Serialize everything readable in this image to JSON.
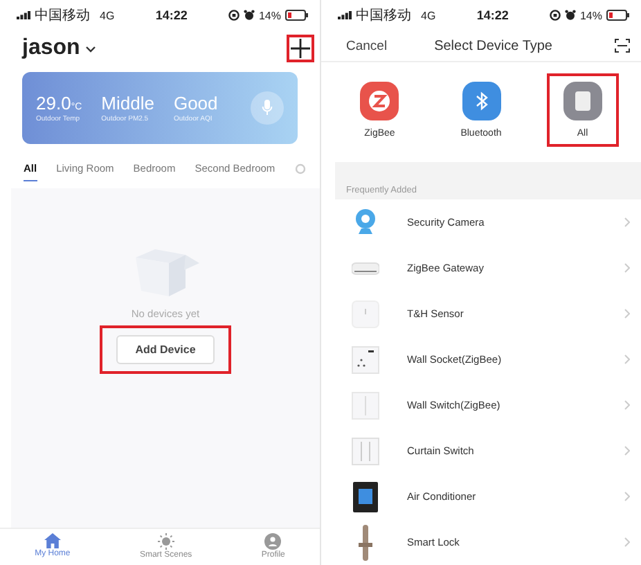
{
  "status_bars": [
    {
      "carrier": "中国移动",
      "network": "4G",
      "time": "14:22",
      "battery": "14%"
    },
    {
      "carrier": "中国移动",
      "network": "4G",
      "time": "14:22",
      "battery": "14%"
    }
  ],
  "home": {
    "home_name": "jason",
    "add_highlighted": true,
    "weather": [
      {
        "value": "29.0",
        "unit": "°C",
        "label": "Outdoor Temp"
      },
      {
        "value": "Middle",
        "label": "Outdoor PM2.5"
      },
      {
        "value": "Good",
        "label": "Outdoor AQI"
      }
    ],
    "rooms": [
      {
        "label": "All",
        "selected": true
      },
      {
        "label": "Living Room",
        "selected": false
      },
      {
        "label": "Bedroom",
        "selected": false
      },
      {
        "label": "Second Bedroom",
        "selected": false
      }
    ],
    "empty_message": "No devices yet",
    "add_device": {
      "label": "Add Device",
      "highlighted": true
    },
    "nav": [
      {
        "label": "My Home",
        "kind": "home",
        "selected": true
      },
      {
        "label": "Smart Scenes",
        "kind": "scenes",
        "selected": false
      },
      {
        "label": "Profile",
        "kind": "profile",
        "selected": false
      }
    ]
  },
  "select_type": {
    "cancel": "Cancel",
    "title": "Select Device Type",
    "types": [
      {
        "label": "ZigBee",
        "kind": "zigbee",
        "highlighted": false
      },
      {
        "label": "Bluetooth",
        "kind": "bluetooth",
        "highlighted": false
      },
      {
        "label": "All",
        "kind": "all",
        "highlighted": true
      }
    ],
    "section": "Frequently Added",
    "devices": [
      {
        "name": "Security Camera",
        "kind": "camera"
      },
      {
        "name": "ZigBee Gateway",
        "kind": "gateway"
      },
      {
        "name": "T&H Sensor",
        "kind": "sensor"
      },
      {
        "name": "Wall Socket(ZigBee)",
        "kind": "socket"
      },
      {
        "name": "Wall Switch(ZigBee)",
        "kind": "switch"
      },
      {
        "name": "Curtain Switch",
        "kind": "curtain"
      },
      {
        "name": "Air Conditioner",
        "kind": "thermostat"
      },
      {
        "name": "Smart Lock",
        "kind": "lock"
      }
    ]
  }
}
